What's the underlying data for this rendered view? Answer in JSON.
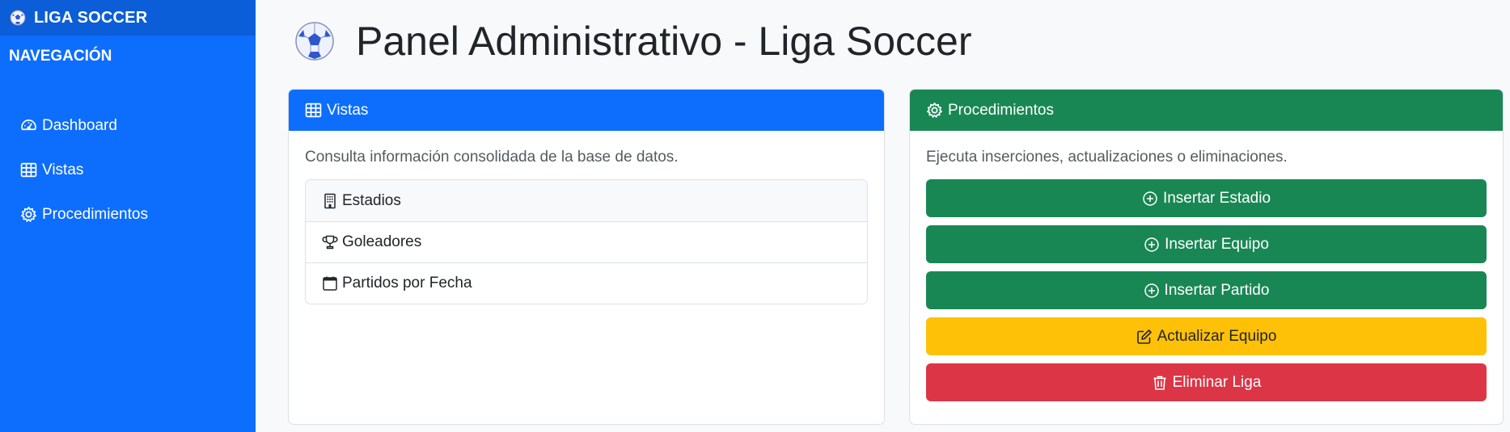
{
  "sidebar": {
    "brand": "LIGA SOCCER",
    "heading": "NAVEGACIÓN",
    "items": [
      {
        "label": "Dashboard",
        "icon": "speedometer-icon"
      },
      {
        "label": "Vistas",
        "icon": "table-icon"
      },
      {
        "label": "Procedimientos",
        "icon": "gear-icon"
      }
    ]
  },
  "main": {
    "title": "Panel Administrativo - Liga Soccer",
    "vistas": {
      "header": "Vistas",
      "description": "Consulta información consolidada de la base de datos.",
      "items": [
        {
          "label": "Estadios",
          "icon": "building-icon"
        },
        {
          "label": "Goleadores",
          "icon": "trophy-icon"
        },
        {
          "label": "Partidos por Fecha",
          "icon": "calendar-icon"
        }
      ]
    },
    "procedimientos": {
      "header": "Procedimientos",
      "description": "Ejecuta inserciones, actualizaciones o eliminaciones.",
      "buttons": [
        {
          "label": "Insertar Estadio",
          "style": "green",
          "icon": "plus-circle-icon"
        },
        {
          "label": "Insertar Equipo",
          "style": "green",
          "icon": "plus-circle-icon"
        },
        {
          "label": "Insertar Partido",
          "style": "green",
          "icon": "plus-circle-icon"
        },
        {
          "label": "Actualizar Equipo",
          "style": "yellow",
          "icon": "pencil-square-icon"
        },
        {
          "label": "Eliminar Liga",
          "style": "red",
          "icon": "trash-icon"
        }
      ]
    }
  },
  "colors": {
    "primary": "#0d6efd",
    "success": "#198754",
    "warning": "#ffc107",
    "danger": "#dc3545"
  }
}
